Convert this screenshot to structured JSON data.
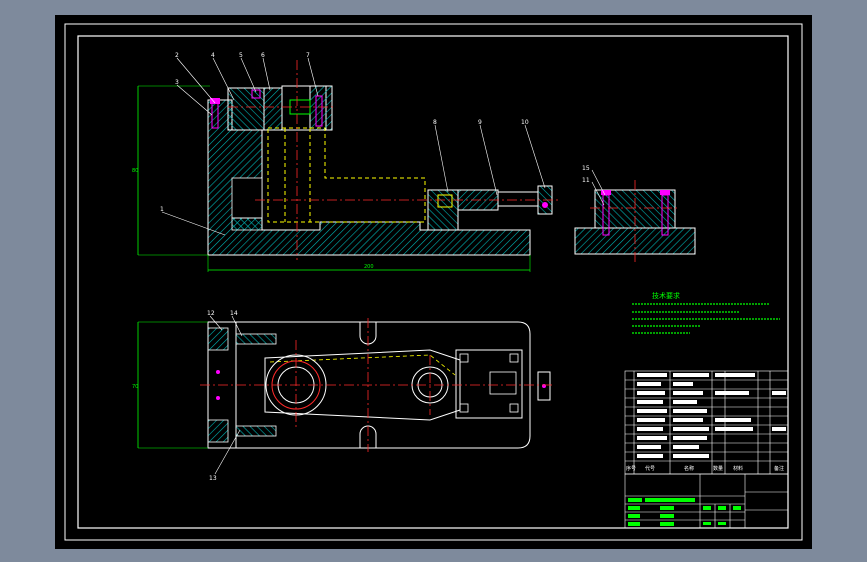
{
  "viewport": {
    "background_color": "#7e8a9c",
    "sheet_color": "#000000",
    "frame_color": "#ffffff"
  },
  "colors": {
    "outline": "#ffffff",
    "hatch": "#00b4b4",
    "centerline": "#ff2a2a",
    "hidden_line": "#ffff00",
    "dimension": "#00ff00",
    "fastener": "#ff00ff",
    "notes_text": "#00ff00"
  },
  "front_view": {
    "balloons": [
      "2",
      "3",
      "4",
      "5",
      "6",
      "7",
      "8",
      "9",
      "10",
      "1"
    ],
    "height_dim": "80",
    "width_dim": "200"
  },
  "side_view": {
    "balloons": [
      "15",
      "11"
    ]
  },
  "top_view": {
    "balloons": [
      "12",
      "13",
      "14"
    ],
    "height_dim": "70"
  },
  "notes": {
    "title": "技术要求"
  },
  "parts_list": {
    "header": [
      "序号",
      "代号",
      "名称",
      "数量",
      "材料",
      "备注"
    ]
  }
}
